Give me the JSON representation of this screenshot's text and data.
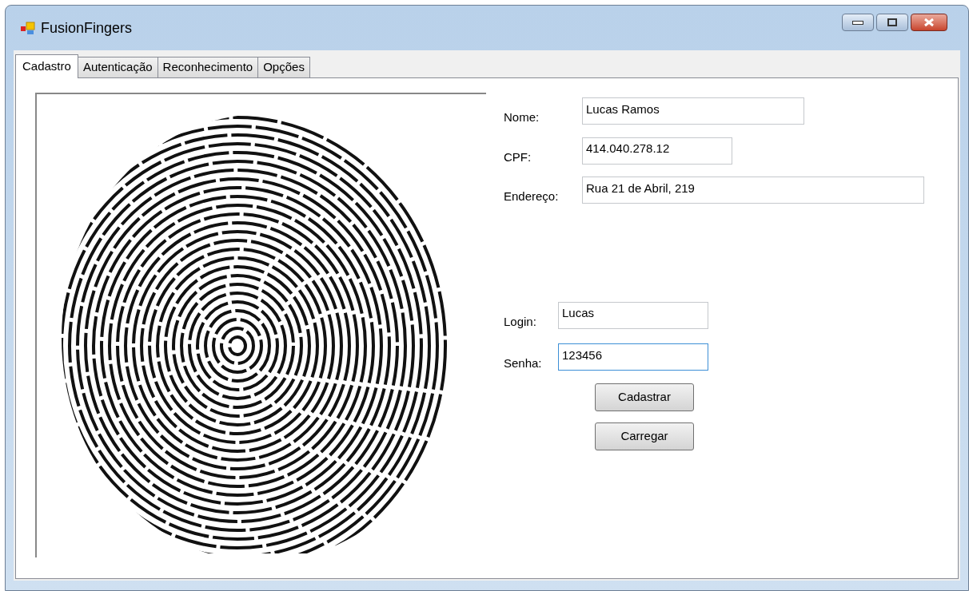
{
  "window": {
    "title": "FusionFingers"
  },
  "tabs": [
    {
      "label": "Cadastro",
      "selected": true
    },
    {
      "label": "Autenticação",
      "selected": false
    },
    {
      "label": "Reconhecimento",
      "selected": false
    },
    {
      "label": "Opções",
      "selected": false
    }
  ],
  "personal_fields": [
    {
      "label": "Nome:",
      "value": "Lucas Ramos",
      "focused": false
    },
    {
      "label": "CPF:",
      "value": "414.040.278.12",
      "focused": false
    },
    {
      "label": "Endereço:",
      "value": "Rua 21 de Abril, 219",
      "focused": false
    }
  ],
  "login_fields": [
    {
      "label": "Login:",
      "value": "Lucas",
      "focused": false
    },
    {
      "label": "Senha:",
      "value": "123456",
      "focused": true
    }
  ],
  "buttons": [
    "Cadastrar",
    "Carregar"
  ]
}
